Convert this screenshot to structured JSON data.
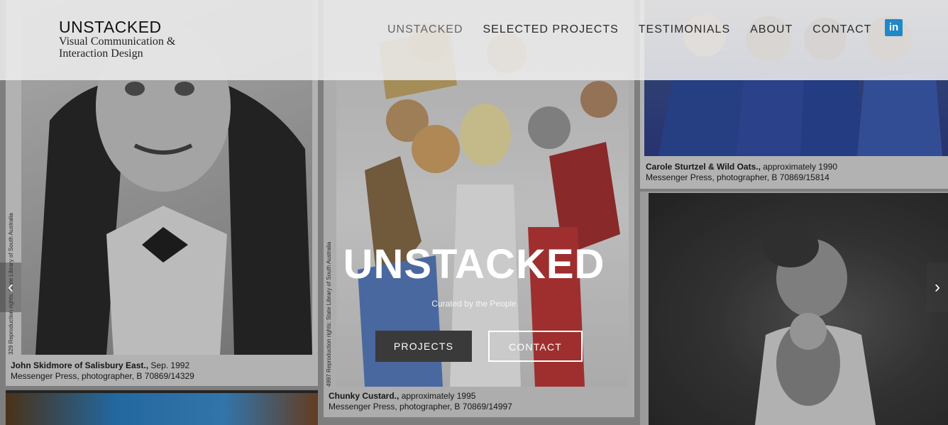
{
  "header": {
    "logo_title": "UNSTACKED",
    "logo_sub_line1": "Visual Communication &",
    "logo_sub_line2": "Interaction Design",
    "nav": [
      {
        "label": "UNSTACKED"
      },
      {
        "label": "SELECTED PROJECTS"
      },
      {
        "label": "TESTIMONIALS"
      },
      {
        "label": "ABOUT"
      },
      {
        "label": "CONTACT"
      }
    ],
    "social_icon": "linkedin-icon",
    "social_text": "in"
  },
  "hero": {
    "title": "UNSTACKED",
    "subtitle": "Curated by the People",
    "primary_button": "PROJECTS",
    "secondary_button": "CONTACT"
  },
  "slider": {
    "prev_icon": "chevron-left-icon",
    "next_icon": "chevron-right-icon",
    "prev_glyph": "‹",
    "next_glyph": "›"
  },
  "collage": {
    "card1": {
      "title": "John Skidmore of Salisbury East.,",
      "date": " Sep. 1992",
      "credit": "Messenger Press, photographer, B 70869/14329",
      "side_text": "329   Reproduction rights: State Library of South Australia"
    },
    "card2": {
      "title": "Chunky Custard.,",
      "date": " approximately 1995",
      "credit": "Messenger Press, photographer, B 70869/14997",
      "side_text": "4997   Reproduction rights: State Library of South Australia"
    },
    "card3": {
      "title": "Carole Sturtzel & Wild Oats.,",
      "date": " approximately 1990",
      "credit": "Messenger Press, photographer, B 70869/15814"
    }
  },
  "colors": {
    "header_bg": "#ececec",
    "linkedin": "#1e88c9",
    "primary_button": "#3a3a3a"
  }
}
